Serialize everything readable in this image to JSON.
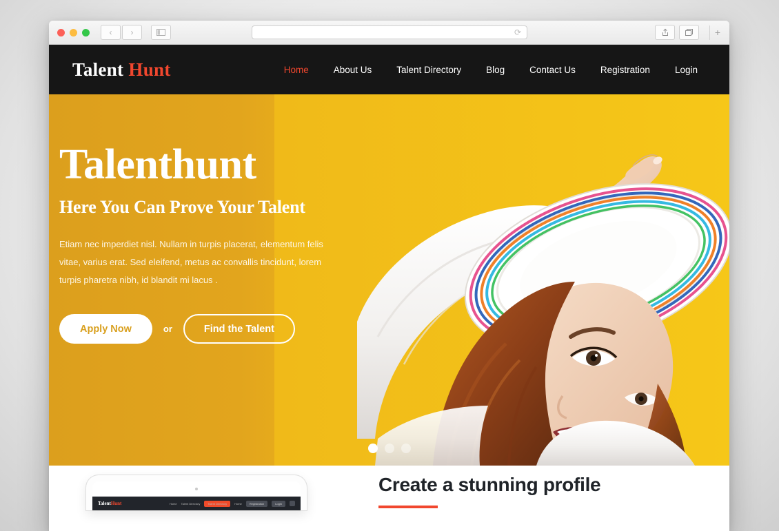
{
  "browser": {
    "traffic_lights": [
      "close",
      "minimize",
      "maximize"
    ],
    "back_icon": "‹",
    "forward_icon": "›",
    "sidebar_icon": "▥",
    "url_value": "",
    "url_placeholder": "",
    "reload_icon": "⟳",
    "share_icon": "↑",
    "tabs_icon": "⧉",
    "new_tab_icon": "+"
  },
  "header": {
    "logo_first": "Talent",
    "logo_second": "Hunt",
    "nav": [
      {
        "label": "Home",
        "active": true
      },
      {
        "label": "About Us",
        "active": false
      },
      {
        "label": "Talent Directory",
        "active": false
      },
      {
        "label": "Blog",
        "active": false
      },
      {
        "label": "Contact Us",
        "active": false
      },
      {
        "label": "Registration",
        "active": false
      },
      {
        "label": "Login",
        "active": false
      }
    ]
  },
  "hero": {
    "title": "Talenthunt",
    "subtitle": "Here You Can Prove Your Talent",
    "paragraph": "Etiam nec imperdiet nisl. Nullam in turpis placerat, elementum felis vitae, varius erat. Sed eleifend, metus ac convallis tincidunt, lorem turpis pharetra nibh, id blandit mi lacus .",
    "primary_button": "Apply Now",
    "separator": "or",
    "secondary_button": "Find the Talent",
    "slides": 3,
    "active_slide": 1,
    "bg_color_left": "#dc9f1d",
    "bg_color_right": "#f5c518",
    "photo_alt": "Smiling woman with red hair wearing a white straw hat with colorful stripes"
  },
  "section": {
    "title": "Create a stunning profile",
    "accent_color": "#f1472e",
    "mockup": {
      "logo_first": "Talent",
      "logo_second": "Hunt",
      "nav": [
        "Home",
        "Talent Directory"
      ],
      "cta": "Talent Directory",
      "buttons": [
        "Registration",
        "Login"
      ]
    }
  }
}
